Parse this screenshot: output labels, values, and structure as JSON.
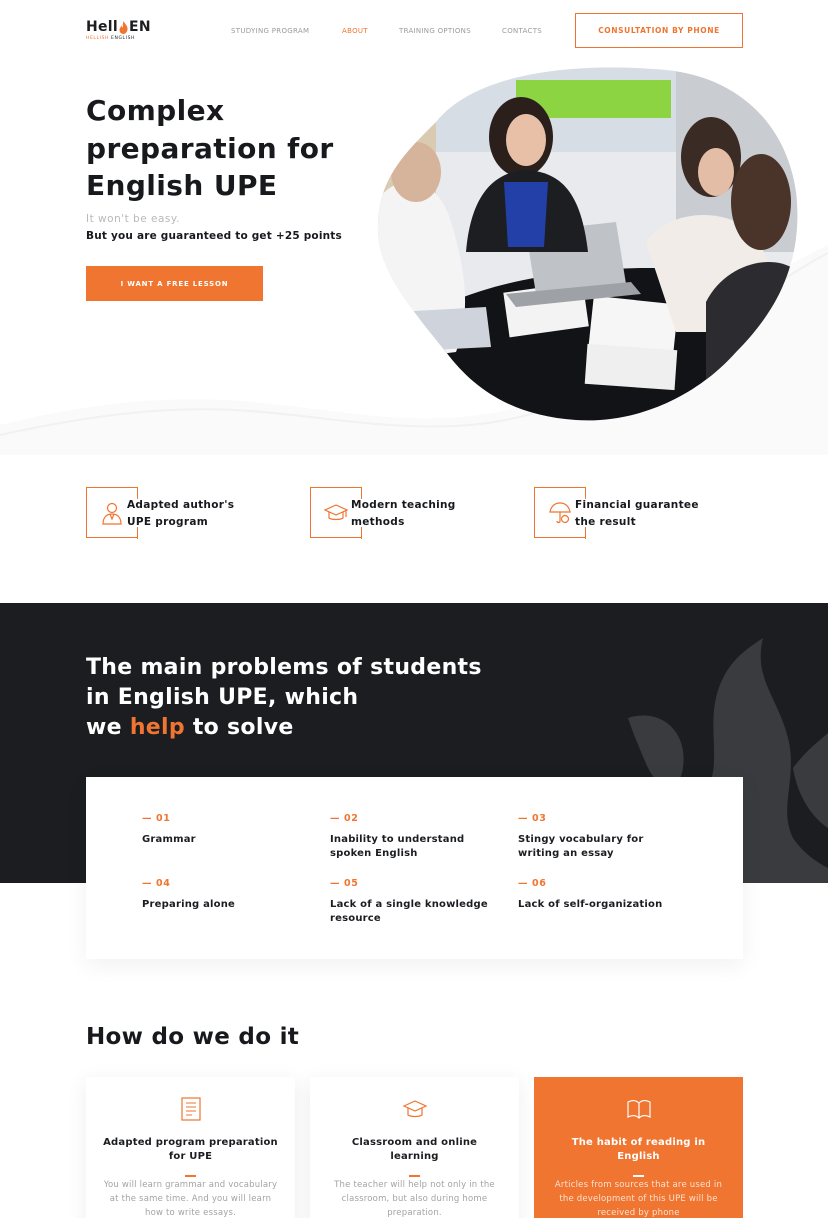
{
  "header": {
    "logo": {
      "main_left": "Hell",
      "main_right": "EN",
      "sub_left": "HELLISH",
      "sub_right": "ENGLISH"
    },
    "nav": [
      {
        "label": "STUDYING PROGRAM",
        "active": false
      },
      {
        "label": "ABOUT",
        "active": true
      },
      {
        "label": "TRAINING OPTIONS",
        "active": false
      },
      {
        "label": "CONTACTS",
        "active": false
      }
    ],
    "cta": "CONSULTATION BY PHONE"
  },
  "hero": {
    "title_lines": [
      "Complex",
      "preparation for",
      "English UPE"
    ],
    "subtitle_muted": "It won't be easy.",
    "subtitle_bold": "But you are guaranteed to get +25 points",
    "button": "I WANT A FREE LESSON"
  },
  "features": [
    {
      "icon": "teacher-icon",
      "line1": "Adapted author's",
      "line2": "UPE program"
    },
    {
      "icon": "graduation-cap-icon",
      "line1": "Modern teaching",
      "line2": "methods"
    },
    {
      "icon": "umbrella-coin-icon",
      "line1": "Financial guarantee",
      "line2": "the result"
    }
  ],
  "problems": {
    "title_line1": "The main problems of students",
    "title_line2": "in English UPE, which",
    "title_line3_pre": "we ",
    "title_line3_hl": "help",
    "title_line3_post": " to solve",
    "items": [
      {
        "num": "— 01",
        "label": "Grammar"
      },
      {
        "num": "— 02",
        "label": "Inability to understand spoken English"
      },
      {
        "num": "— 03",
        "label": "Stingy vocabulary for writing an essay"
      },
      {
        "num": "— 04",
        "label": "Preparing alone"
      },
      {
        "num": "— 05",
        "label": "Lack of a single knowledge resource"
      },
      {
        "num": "— 06",
        "label": "Lack of self-organization"
      }
    ]
  },
  "how": {
    "title": "How do we do it",
    "cards": [
      {
        "icon": "document-icon",
        "title": "Adapted program preparation for UPE",
        "text": "You will learn grammar and vocabulary at the same time. And you will learn how to write essays."
      },
      {
        "icon": "graduation-cap-icon",
        "title": "Classroom and online learning",
        "text": "The teacher will help not only in the classroom, but also during home preparation."
      },
      {
        "icon": "book-icon",
        "title": "The habit of reading in English",
        "text": "Articles from sources that are used in the development of this UPE will be received by phone"
      }
    ]
  },
  "colors": {
    "accent": "#ef7531",
    "dark": "#1b1d21"
  }
}
